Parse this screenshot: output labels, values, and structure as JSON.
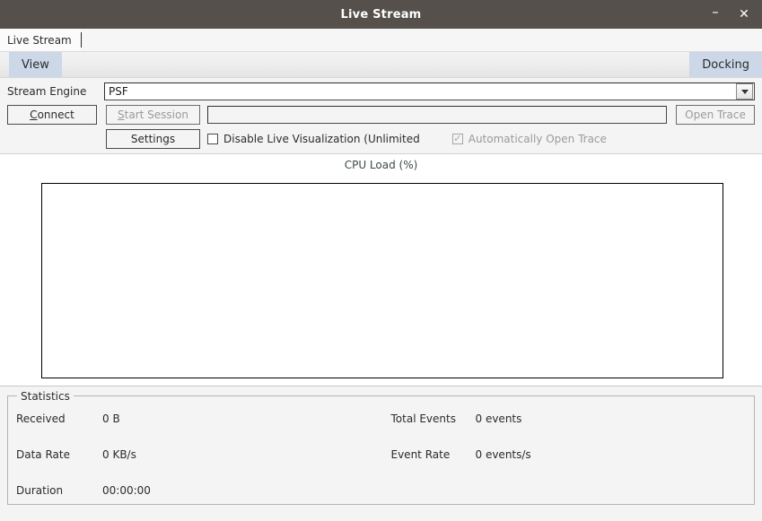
{
  "window": {
    "title": "Live Stream",
    "minimize_label": "–",
    "close_label": "✕"
  },
  "tabs": [
    {
      "label": "Live Stream"
    }
  ],
  "toolbar": {
    "view_label": "View",
    "docking_label": "Docking",
    "accent_color": "#ccd7e8"
  },
  "form": {
    "stream_engine_label": "Stream Engine",
    "stream_engine_value": "PSF",
    "connect_label": "Connect",
    "connect_mnemonic": "C",
    "connect_rest": "onnect",
    "start_session_label": "Start Session",
    "start_session_mnemonic": "S",
    "start_session_rest": "tart Session",
    "session_path_value": "",
    "session_path_placeholder": "",
    "open_trace_label": "Open Trace",
    "settings_label": "Settings",
    "disable_live_viz_label": "Disable Live Visualization (Unlimited",
    "disable_live_viz_checked": false,
    "auto_open_trace_label": "Automatically Open Trace",
    "auto_open_trace_checked": true,
    "auto_open_trace_tick": "✓"
  },
  "chart_data": {
    "type": "line",
    "title": "CPU Load (%)",
    "xlabel": "",
    "ylabel": "",
    "series": [],
    "categories": [],
    "values": [],
    "grid": false,
    "legend": "none",
    "empty": true
  },
  "statistics": {
    "group_title": "Statistics",
    "left": [
      {
        "label": "Received",
        "value": "0 B"
      },
      {
        "label": "Data Rate",
        "value": "0 KB/s"
      },
      {
        "label": "Duration",
        "value": "00:00:00"
      }
    ],
    "right": [
      {
        "label": "Total Events",
        "value": "0 events"
      },
      {
        "label": "Event Rate",
        "value": "0 events/s"
      }
    ]
  }
}
